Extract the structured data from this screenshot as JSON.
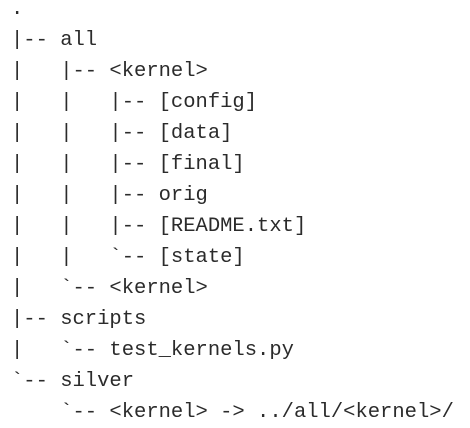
{
  "tree": {
    "lines": [
      ".",
      "|-- all",
      "|   |-- <kernel>",
      "|   |   |-- [config]",
      "|   |   |-- [data]",
      "|   |   |-- [final]",
      "|   |   |-- orig",
      "|   |   |-- [README.txt]",
      "|   |   `-- [state]",
      "|   `-- <kernel>",
      "|-- scripts",
      "|   `-- test_kernels.py",
      "`-- silver",
      "    `-- <kernel> -> ../all/<kernel>/"
    ]
  }
}
